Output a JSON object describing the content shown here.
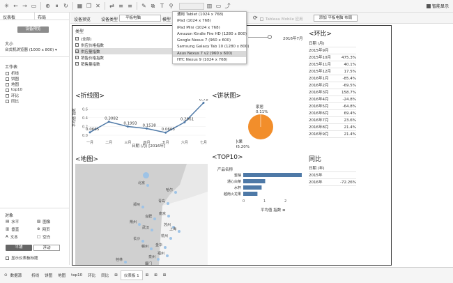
{
  "toolbar": {
    "smart": "智能显示"
  },
  "left": {
    "tab1": "仪表板",
    "tab2": "布局",
    "preset_btn": "设备预览",
    "size_label": "大小",
    "size_value": "台式机浏览器 (1000 x 800)",
    "sheets_label": "工作表",
    "sheets": [
      "折线",
      "饼图",
      "地图",
      "top10",
      "环比",
      "同比"
    ],
    "objects_label": "对象",
    "objects": [
      "水平",
      "图像",
      "垂直",
      "网页",
      "文本",
      "空白"
    ],
    "tiled": "平铺",
    "floating": "浮动",
    "show_title": "显示仪表板标题"
  },
  "top": {
    "preview": "设备预览",
    "device_type": "设备类型",
    "device": "平板电脑",
    "model": "模型",
    "tableau_mobile": "Tableau Mobile 应用",
    "add_layout": "添加 平板电脑 布局"
  },
  "dropdown": [
    "通用 Tablet (1024 x 768)",
    "iPad (1024 x 768)",
    "iPad Mini (1024 x 768)",
    "Amazon Kindle Fire HD (1280 x 800)",
    "Google Nexus 7 (960 x 600)",
    "Samsung Galaxy Tab 10 (1280 x 800)",
    "Asus Nexus 7 v2 (960 x 600)",
    "HTC Nexus 9 (1024 x 768)"
  ],
  "filter": {
    "title": "类型",
    "items": [
      "(全部)",
      "供应价格指数",
      "供应量指数",
      "销售价格指数",
      "销售量指数"
    ],
    "slider_date": "2016年7月"
  },
  "huanbi": {
    "title": "<环比>",
    "header": "日期 (月)",
    "rows": [
      [
        "2015年9月",
        ""
      ],
      [
        "2015年10月",
        "475.3%"
      ],
      [
        "2015年11月",
        "40.1%"
      ],
      [
        "2015年12月",
        "17.5%"
      ],
      [
        "2016年1月",
        "-85.4%"
      ],
      [
        "2016年2月",
        "-69.5%"
      ],
      [
        "2016年3月",
        "158.7%"
      ],
      [
        "2016年4月",
        "-24.8%"
      ],
      [
        "2016年5月",
        "-64.8%"
      ],
      [
        "2016年6月",
        "69.4%"
      ],
      [
        "2016年7月",
        "23.6%"
      ],
      [
        "2016年8月",
        "21.4%"
      ],
      [
        "2016年9月",
        "21.4%"
      ]
    ]
  },
  "line": {
    "title": "<折线图>",
    "ylabel": "平均值 指数",
    "xlabel": "日期 (月) [2016年]"
  },
  "pie": {
    "title": "<饼状图>"
  },
  "map": {
    "title": "<地图>",
    "cities": [
      "北京",
      "哈尔",
      "青岛",
      "郑州",
      "合肥",
      "南京",
      "荆州",
      "苏州",
      "武汉",
      "上海",
      "长沙",
      "杭州",
      "赣州",
      "金华",
      "福州",
      "泉州",
      "桂林",
      "厦门"
    ]
  },
  "top10": {
    "title": "<TOP10>",
    "header": "产品名称",
    "xlabel": "平均值 指数",
    "ticks": [
      "0",
      "1",
      "2"
    ]
  },
  "tongbi": {
    "title": "同比",
    "header": "日期 (年)",
    "rows": [
      [
        "2015年",
        ""
      ],
      [
        "2016年",
        "-72.26%"
      ]
    ]
  },
  "bottom": {
    "tabs": [
      "数据源",
      "折线",
      "饼图",
      "地图",
      "top10",
      "环比",
      "同比",
      "仪表板 1"
    ]
  },
  "chart_data": [
    {
      "type": "line",
      "categories": [
        "一月",
        "二月",
        "三月",
        "四月",
        "五月",
        "六月",
        "七月"
      ],
      "values": [
        0.0665,
        0.3082,
        0.1993,
        0.1538,
        0.0603,
        0.2961,
        0.7397
      ],
      "ylabel": "平均值 指数",
      "xlabel": "日期 (月) [2016年]",
      "ylim": [
        0,
        0.7
      ],
      "yticks": [
        "0.6",
        "0.4",
        "0.2",
        "0.0"
      ]
    },
    {
      "type": "pie",
      "slices": [
        {
          "label": "家居",
          "value": 0.11,
          "text": "0.11%"
        },
        {
          "label": "水果",
          "value": 95.2,
          "text": "95.20%"
        }
      ],
      "colors": [
        "#f28e2b",
        "#f28e2b"
      ]
    },
    {
      "type": "bar",
      "categories": [
        "蜜柚",
        "通心白菜",
        "水杯",
        "越南火龙果"
      ],
      "values": [
        2.8,
        1.05,
        0.88,
        0.68
      ],
      "xlim": [
        0,
        3
      ],
      "color": "#4e79a7"
    }
  ]
}
